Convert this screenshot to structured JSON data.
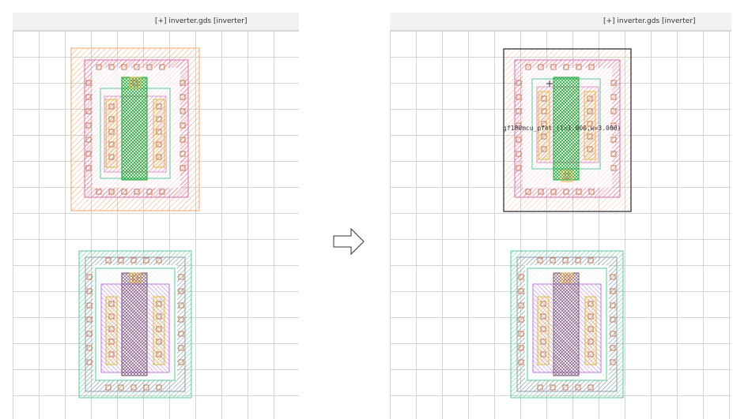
{
  "left_panel": {
    "window_title": "[+] inverter.gds [inverter]"
  },
  "right_panel": {
    "window_title": "[+] inverter.gds [inverter]",
    "cell_label": "gf180mcu_pfet_(l=1.000,w=3.000)"
  },
  "arrow_icon": "right-arrow-icon",
  "colors": {
    "nwell": "#f4a46b",
    "diff": "#d46fb1",
    "poly": "#22a83a",
    "contact": "#c77a56",
    "metal": "#e1b83a",
    "implant": "#59c998",
    "pwell": "#a9a9c9",
    "selection": "#333333"
  }
}
